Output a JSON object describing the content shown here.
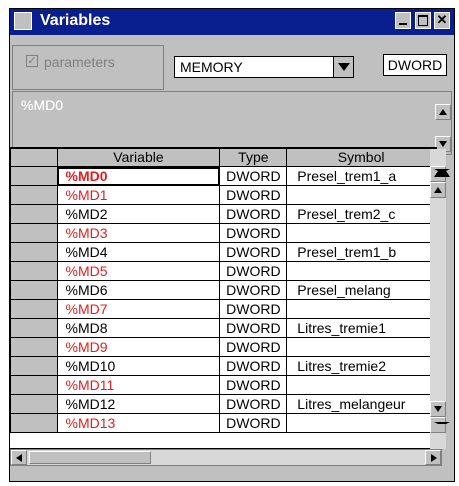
{
  "window": {
    "title": "Variables"
  },
  "controls": {
    "parameters_label": "parameters",
    "memory_select": "MEMORY",
    "dtype": "DWORD"
  },
  "address_field": {
    "value": "%MD0"
  },
  "table": {
    "headers": [
      "Variable",
      "Type",
      "Symbol"
    ],
    "rows": [
      {
        "variable": "%MD0",
        "type": "DWORD",
        "symbol": "Presel_trem1_a",
        "red": true
      },
      {
        "variable": "%MD1",
        "type": "DWORD",
        "symbol": "",
        "red": true
      },
      {
        "variable": "%MD2",
        "type": "DWORD",
        "symbol": "Presel_trem2_c",
        "red": false
      },
      {
        "variable": "%MD3",
        "type": "DWORD",
        "symbol": "",
        "red": true
      },
      {
        "variable": "%MD4",
        "type": "DWORD",
        "symbol": "Presel_trem1_b",
        "red": false
      },
      {
        "variable": "%MD5",
        "type": "DWORD",
        "symbol": "",
        "red": true
      },
      {
        "variable": "%MD6",
        "type": "DWORD",
        "symbol": "Presel_melang",
        "red": false
      },
      {
        "variable": "%MD7",
        "type": "DWORD",
        "symbol": "",
        "red": true
      },
      {
        "variable": "%MD8",
        "type": "DWORD",
        "symbol": "Litres_tremie1",
        "red": false
      },
      {
        "variable": "%MD9",
        "type": "DWORD",
        "symbol": "",
        "red": true
      },
      {
        "variable": "%MD10",
        "type": "DWORD",
        "symbol": "Litres_tremie2",
        "red": false
      },
      {
        "variable": "%MD11",
        "type": "DWORD",
        "symbol": "",
        "red": true
      },
      {
        "variable": "%MD12",
        "type": "DWORD",
        "symbol": "Litres_melangeur",
        "red": false
      },
      {
        "variable": "%MD13",
        "type": "DWORD",
        "symbol": "",
        "red": true
      }
    ]
  },
  "colors": {
    "titlebar": "#0a1f8f",
    "highlight": "#e02020"
  }
}
